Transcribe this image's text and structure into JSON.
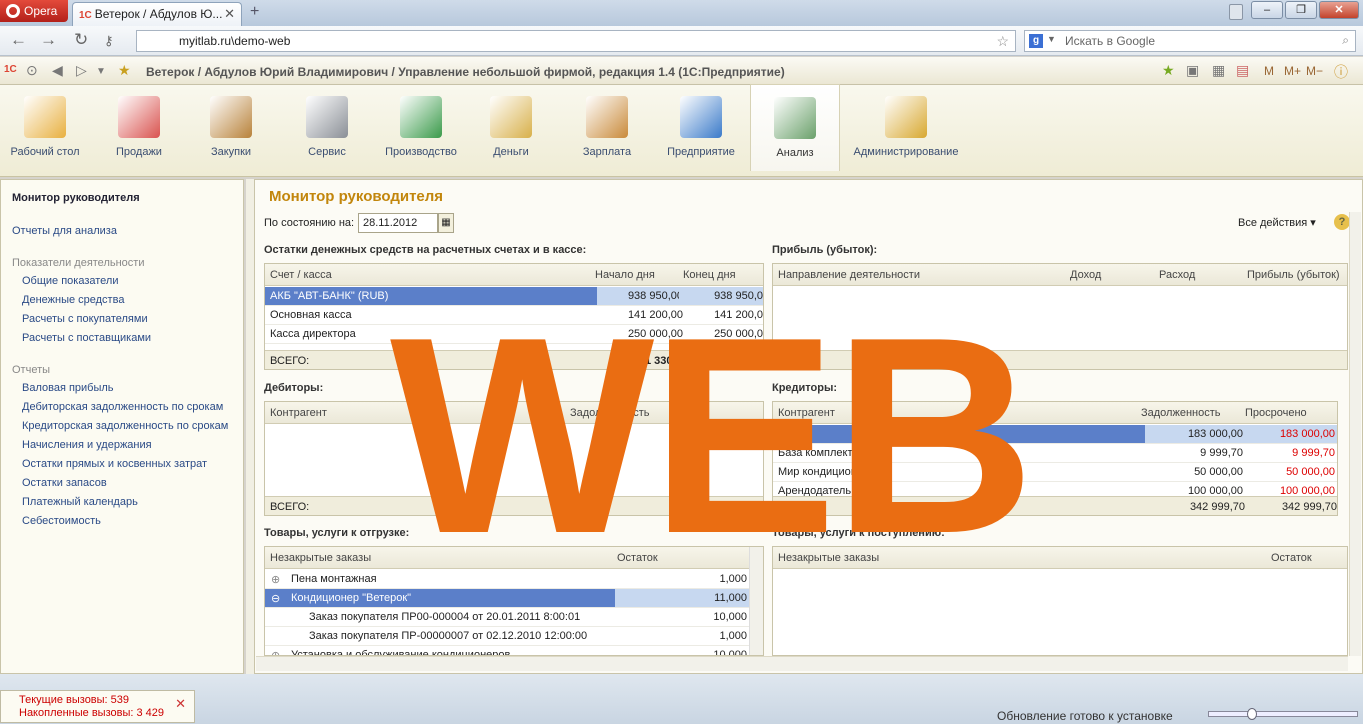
{
  "browser": {
    "opera_label": "Opera",
    "tab_title": "Ветерок / Абдулов Ю...",
    "url": "myitlab.ru\\demo-web",
    "search_placeholder": "Искать в Google"
  },
  "app": {
    "title": "Ветерок / Абдулов Юрий Владимирович / Управление небольшой фирмой, редакция 1.4 (1С:Предприятие)",
    "toolbar_right": [
      "M",
      "M+",
      "M−"
    ]
  },
  "sections": [
    {
      "label": "Рабочий стол",
      "icon": "desk-lamp-icon",
      "color": "#e8b040"
    },
    {
      "label": "Продажи",
      "icon": "shopping-basket-icon",
      "color": "#d9534f"
    },
    {
      "label": "Закупки",
      "icon": "boxes-cart-icon",
      "color": "#b8823a"
    },
    {
      "label": "Сервис",
      "icon": "tools-icon",
      "color": "#8a8f96"
    },
    {
      "label": "Производство",
      "icon": "factory-icon",
      "color": "#3a9a4a"
    },
    {
      "label": "Деньги",
      "icon": "coins-icon",
      "color": "#d8b04a"
    },
    {
      "label": "Зарплата",
      "icon": "worker-coins-icon",
      "color": "#c98a3a"
    },
    {
      "label": "Предприятие",
      "icon": "office-building-icon",
      "color": "#3a7ac9"
    },
    {
      "label": "Анализ",
      "icon": "chart-analysis-icon",
      "color": "#6aa06a",
      "active": true
    },
    {
      "label": "Администрирование",
      "icon": "computer-database-icon",
      "color": "#d8a830"
    }
  ],
  "left_nav": {
    "title": "Монитор руководителя",
    "reports_link": "Отчеты для анализа",
    "group1_title": "Показатели деятельности",
    "group1": [
      "Общие показатели",
      "Денежные средства",
      "Расчеты с покупателями",
      "Расчеты с поставщиками"
    ],
    "group2_title": "Отчеты",
    "group2": [
      "Валовая прибыль",
      "Дебиторская задолженность по срокам",
      "Кредиторская задолженность по срокам",
      "Начисления и удержания",
      "Остатки прямых и косвенных затрат",
      "Остатки запасов",
      "Платежный календарь",
      "Себестоимость"
    ]
  },
  "main": {
    "title": "Монитор руководителя",
    "date_label": "По состоянию на:",
    "date_value": "28.11.2012",
    "all_actions": "Все действия ▾",
    "help": "?",
    "cash": {
      "title": "Остатки денежных средств на расчетных счетах и в кассе:",
      "headers": [
        "Счет / касса",
        "Начало дня",
        "Конец дня"
      ],
      "rows": [
        {
          "name": "АКБ \"АВТ-БАНК\" (RUB)",
          "start": "938 950,00",
          "end": "938 950,0"
        },
        {
          "name": "Основная касса",
          "start": "141 200,00",
          "end": "141 200,0"
        },
        {
          "name": "Касса директора",
          "start": "250 000,00",
          "end": "250 000,0"
        }
      ],
      "total_label": "ВСЕГО:",
      "total_start": "1 330 150"
    },
    "profit": {
      "title": "Прибыль (убыток):",
      "headers": [
        "Направление деятельности",
        "Доход",
        "Расход",
        "Прибыль (убыток)"
      ],
      "total_label": "ВСЕГО:"
    },
    "debtors": {
      "title": "Дебиторы:",
      "headers": [
        "Контрагент",
        "Задолженность"
      ],
      "total_label": "ВСЕГО:"
    },
    "creditors": {
      "title": "Кредиторы:",
      "headers": [
        "Контрагент",
        "Задолженность",
        "Просрочено"
      ],
      "rows": [
        {
          "name": "",
          "debt": "183 000,00",
          "overdue": "183 000,00"
        },
        {
          "name": "База комплектующих",
          "debt": "9 999,70",
          "overdue": "9 999,70"
        },
        {
          "name": "Мир кондиционеров",
          "debt": "50 000,00",
          "overdue": "50 000,00"
        },
        {
          "name": "Арендодатель",
          "debt": "100 000,00",
          "overdue": "100 000,00"
        }
      ],
      "total_debt": "342 999,70",
      "total_overdue": "342 999,70"
    },
    "shipments": {
      "title": "Товары, услуги к отгрузке:",
      "headers": [
        "Незакрытые заказы",
        "Остаток"
      ],
      "rows": [
        {
          "name": "Пена монтажная",
          "qty": "1,000",
          "level": 0,
          "toggle": "⊕"
        },
        {
          "name": "Кондиционер \"Ветерок\"",
          "qty": "11,000",
          "level": 0,
          "toggle": "⊖",
          "selected": true
        },
        {
          "name": "Заказ покупателя ПР00-000004 от 20.01.2011 8:00:01",
          "qty": "10,000",
          "level": 1
        },
        {
          "name": "Заказ покупателя ПР-00000007 от 02.12.2010 12:00:00",
          "qty": "1,000",
          "level": 1
        },
        {
          "name": "Установка и обслуживание кондиционеров",
          "qty": "10,000",
          "level": 0,
          "toggle": "⊕"
        }
      ]
    },
    "receipts": {
      "title": "Товары, услуги к поступлению:",
      "headers": [
        "Незакрытые заказы",
        "Остаток"
      ]
    }
  },
  "status": {
    "current_calls": "Текущие вызовы: 539",
    "accumulated_calls": "Накопленные вызовы: 3 429",
    "update": "Обновление готово к установке"
  },
  "watermark": "WEB"
}
